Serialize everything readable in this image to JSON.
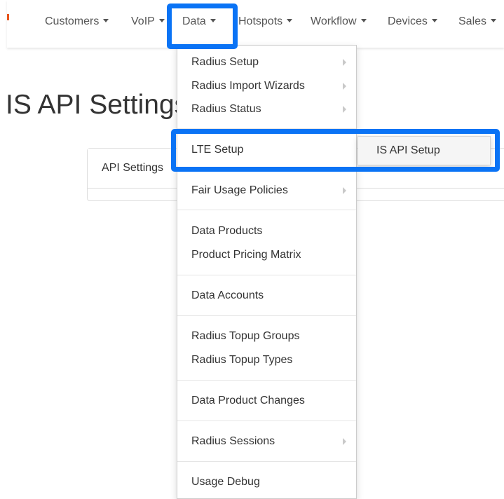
{
  "nav": {
    "items": [
      {
        "label": "Customers"
      },
      {
        "label": "VoIP"
      },
      {
        "label": "Data"
      },
      {
        "label": "Hotspots"
      },
      {
        "label": "Workflow"
      },
      {
        "label": "Devices"
      },
      {
        "label": "Sales"
      }
    ]
  },
  "page": {
    "title": "IS API Settings"
  },
  "panel": {
    "tab_label": "API Settings"
  },
  "data_menu": {
    "groups": [
      [
        {
          "label": "Radius Setup",
          "submenu": true
        },
        {
          "label": "Radius Import Wizards",
          "submenu": true
        },
        {
          "label": "Radius Status",
          "submenu": true
        }
      ],
      [
        {
          "label": "LTE Setup",
          "submenu": false
        }
      ],
      [
        {
          "label": "Fair Usage Policies",
          "submenu": true
        }
      ],
      [
        {
          "label": "Data Products",
          "submenu": false
        },
        {
          "label": "Product Pricing Matrix",
          "submenu": false
        }
      ],
      [
        {
          "label": "Data Accounts",
          "submenu": false
        }
      ],
      [
        {
          "label": "Radius Topup Groups",
          "submenu": false
        },
        {
          "label": "Radius Topup Types",
          "submenu": false
        }
      ],
      [
        {
          "label": "Data Product Changes",
          "submenu": false
        }
      ],
      [
        {
          "label": "Radius Sessions",
          "submenu": true
        }
      ],
      [
        {
          "label": "Usage Debug",
          "submenu": false
        }
      ]
    ]
  },
  "lte_submenu": {
    "items": [
      {
        "label": "IS API Setup"
      }
    ]
  },
  "colors": {
    "highlight": "#0a73f5",
    "brand": "#e8541c"
  }
}
